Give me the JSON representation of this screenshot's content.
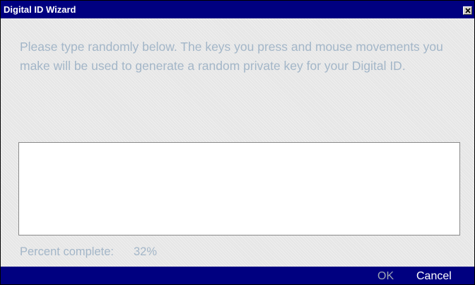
{
  "window": {
    "title": "Digital ID Wizard"
  },
  "titlebar": {
    "close_icon": "close-x-icon"
  },
  "content": {
    "instructions": "Please type randomly below. The keys you press and mouse movements you make will be used to generate a random private key for your Digital ID.",
    "input_value": "",
    "progress_label": "Percent complete:",
    "progress_value": "32%",
    "progress_fraction": 0.32
  },
  "buttons": {
    "ok_label": "OK",
    "ok_enabled": false,
    "cancel_label": "Cancel"
  },
  "colors": {
    "titlebar": "#000080",
    "background": "#e6e6e6",
    "text": "#a3b6c8",
    "disabled_button_text": "#9aa3b3"
  }
}
